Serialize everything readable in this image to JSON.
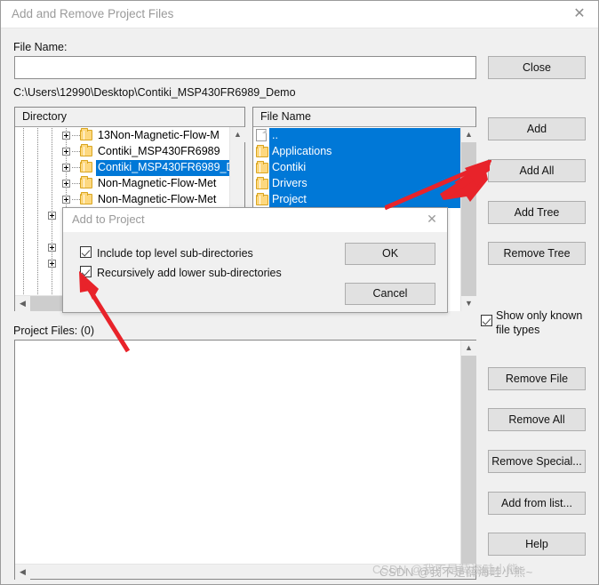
{
  "window": {
    "title": "Add and Remove Project Files",
    "close_icon": "close-icon"
  },
  "form": {
    "file_name_label": "File Name:",
    "file_name_value": "",
    "file_name_placeholder": "",
    "current_path": "C:\\Users\\12990\\Desktop\\Contiki_MSP430FR6989_Demo"
  },
  "directory_panel": {
    "header": "Directory",
    "rows": [
      {
        "label": "13Non-Magnetic-Flow-M",
        "selected": false
      },
      {
        "label": "Contiki_MSP430FR6989",
        "selected": false
      },
      {
        "label": "Contiki_MSP430FR6989_D",
        "selected": true
      },
      {
        "label": "Non-Magnetic-Flow-Met",
        "selected": false
      },
      {
        "label": "Non-Magnetic-Flow-Met",
        "selected": false
      }
    ],
    "scroll_up_icon": "chevron-up-icon",
    "scroll_down_icon": "chevron-down-icon",
    "scroll_left_icon": "chevron-left-icon",
    "scroll_right_icon": "chevron-right-icon"
  },
  "file_panel": {
    "header": "File Name",
    "rows": [
      {
        "label": "..",
        "icon": "document-icon",
        "selected": true
      },
      {
        "label": "Applications",
        "icon": "folder-icon",
        "selected": true
      },
      {
        "label": "Contiki",
        "icon": "folder-icon",
        "selected": true
      },
      {
        "label": "Drivers",
        "icon": "folder-icon",
        "selected": true
      },
      {
        "label": "Project",
        "icon": "folder-icon",
        "selected": true
      }
    ],
    "scroll_up_icon": "chevron-up-icon",
    "scroll_down_icon": "chevron-down-icon"
  },
  "project_files": {
    "label": "Project Files: (0)",
    "count": 0,
    "items": [],
    "scroll_up_icon": "chevron-up-icon",
    "scroll_left_icon": "chevron-left-icon"
  },
  "buttons": {
    "close": "Close",
    "add": "Add",
    "add_all": "Add All",
    "add_tree": "Add Tree",
    "remove_tree": "Remove Tree",
    "remove_file": "Remove File",
    "remove_all": "Remove All",
    "remove_special": "Remove Special...",
    "add_from_list": "Add from list...",
    "help": "Help"
  },
  "options": {
    "show_known_line1": "Show only known",
    "show_known_line2": "file types",
    "show_known_checked": true
  },
  "modal": {
    "title": "Add to Project",
    "close_icon": "close-icon",
    "checkbox_top_level": "Include top level sub-directories",
    "checkbox_top_level_checked": true,
    "checkbox_recursive": "Recursively add lower sub-directories",
    "checkbox_recursive_checked": true,
    "ok": "OK",
    "cancel": "Cancel"
  },
  "annotations": {
    "arrow_color": "#e8232a",
    "arrow_add_all": "arrow pointing to Add All button",
    "arrow_recursive": "arrow pointing to Recursively add lower sub-directories checkbox"
  },
  "watermark": {
    "text": "CSDN @我不是薛海畦小熊~",
    "text2": "CSDN @我不是薛海畦小熊~"
  },
  "colors": {
    "selection_blue": "#0078d7",
    "button_face": "#e1e1e1",
    "dialog_face": "#f0f0f0",
    "folder_yellow": "#fdd87f"
  }
}
